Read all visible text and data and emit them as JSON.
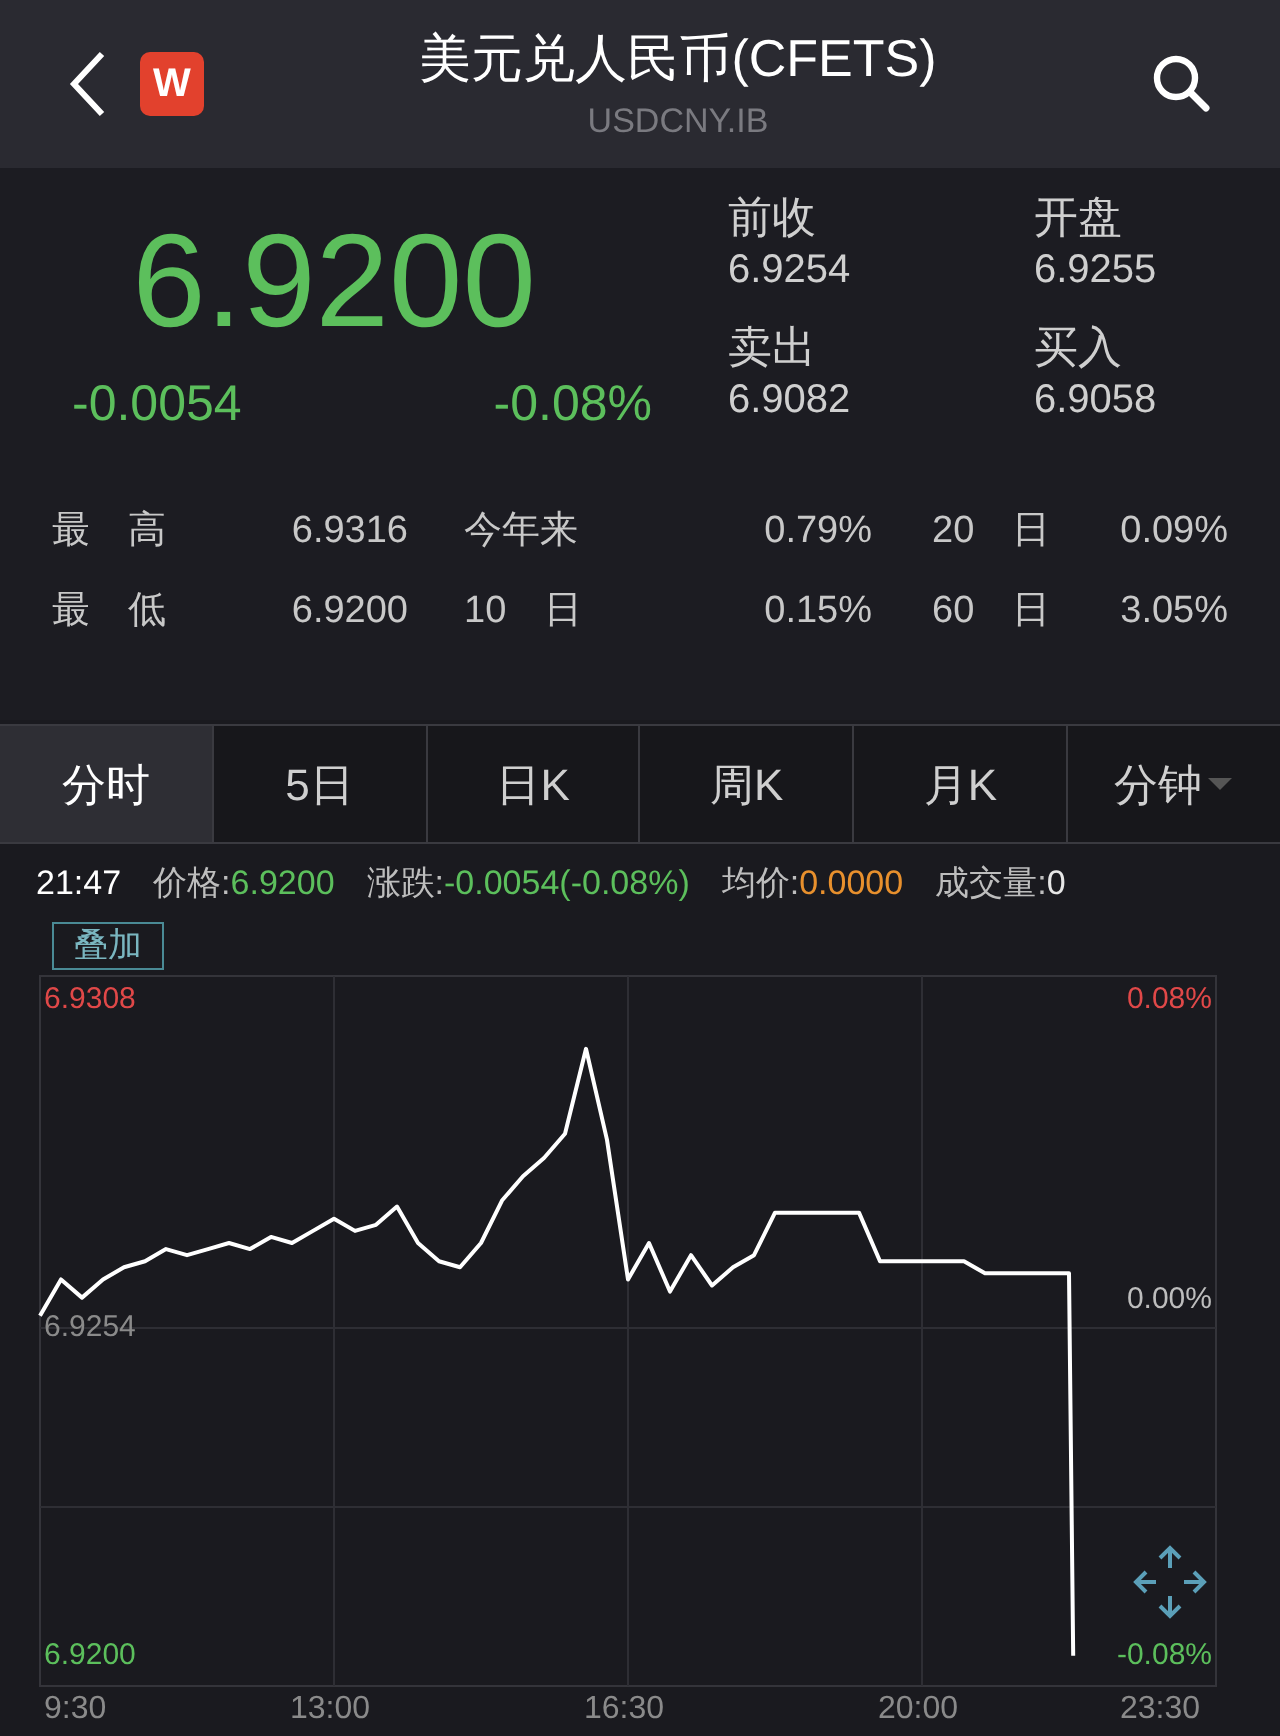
{
  "header": {
    "logo": "W",
    "title": "美元兑人民币(CFETS)",
    "subtitle": "USDCNY.IB"
  },
  "quote": {
    "price": "6.9200",
    "change": "-0.0054",
    "change_pct": "-0.08%",
    "fields": [
      {
        "label": "前收",
        "value": "6.9254"
      },
      {
        "label": "开盘",
        "value": "6.9255"
      },
      {
        "label": "卖出",
        "value": "6.9082"
      },
      {
        "label": "买入",
        "value": "6.9058"
      }
    ]
  },
  "stats": [
    [
      {
        "label": "最　高",
        "value": "6.9316"
      },
      {
        "label": "今年来",
        "value": "0.79%"
      },
      {
        "label": "20　日",
        "value": "0.09%"
      }
    ],
    [
      {
        "label": "最　低",
        "value": "6.9200"
      },
      {
        "label": "10　日",
        "value": "0.15%"
      },
      {
        "label": "60　日",
        "value": "3.05%"
      }
    ]
  ],
  "tabs": [
    {
      "label": "分时",
      "selected": true,
      "has_menu": false
    },
    {
      "label": "5日",
      "selected": false,
      "has_menu": false
    },
    {
      "label": "日K",
      "selected": false,
      "has_menu": false
    },
    {
      "label": "周K",
      "selected": false,
      "has_menu": false
    },
    {
      "label": "月K",
      "selected": false,
      "has_menu": false
    },
    {
      "label": "分钟",
      "selected": false,
      "has_menu": true
    }
  ],
  "info_line": {
    "time": "21:47",
    "items": [
      {
        "label": "价格:",
        "value": "6.9200",
        "color": "#5cbf5c"
      },
      {
        "label": "涨跌:",
        "value": "-0.0054(-0.08%)",
        "color": "#5cbf5c"
      },
      {
        "label": "均价:",
        "value": "0.0000",
        "color": "#e8902d"
      },
      {
        "label": "成交量:",
        "value": "0",
        "color": "#e6e6e6"
      }
    ]
  },
  "overlay_button": "叠加",
  "chart": {
    "right_labels": [
      {
        "label": "0.08%",
        "color": "#e04848"
      },
      {
        "label": "0.00%",
        "color": "#bdbdbd"
      },
      {
        "label": "-0.08%",
        "color": "#5cbf5c"
      }
    ],
    "chart_data": {
      "type": "line",
      "grid": true,
      "xlim": [
        9.5,
        23.5
      ],
      "ylim": [
        6.9195,
        6.9312
      ],
      "x": [
        9.5,
        9.75,
        10,
        10.25,
        10.5,
        10.75,
        11,
        11.25,
        11.5,
        11.75,
        12,
        12.25,
        12.5,
        12.75,
        13,
        13.25,
        13.5,
        13.75,
        14,
        14.25,
        14.5,
        14.75,
        15,
        15.25,
        15.5,
        15.75,
        16,
        16.25,
        16.5,
        16.75,
        17,
        17.25,
        17.5,
        17.75,
        18,
        18.25,
        18.5,
        18.75,
        19,
        19.25,
        19.5,
        19.75,
        20,
        20.25,
        20.5,
        20.75,
        21,
        21.25,
        21.5,
        21.75,
        21.8
      ],
      "xticks": [
        {
          "value": 9.5,
          "label": "9:30"
        },
        {
          "value": 13,
          "label": "13:00"
        },
        {
          "value": 16.5,
          "label": "16:30"
        },
        {
          "value": 20,
          "label": "20:00"
        },
        {
          "value": 23.5,
          "label": "23:30"
        }
      ],
      "yticks": [
        {
          "value": 6.9308,
          "label": "6.9308"
        },
        {
          "value": 6.9254,
          "label": "6.9254"
        },
        {
          "value": 6.92,
          "label": "6.9200"
        }
      ],
      "series": [
        {
          "color": "#ffffff",
          "values": [
            6.9256,
            6.9262,
            6.9259,
            6.9262,
            6.9264,
            6.9265,
            6.9267,
            6.9266,
            6.9267,
            6.9268,
            6.9267,
            6.9269,
            6.9268,
            6.927,
            6.9272,
            6.927,
            6.9271,
            6.9274,
            6.9268,
            6.9265,
            6.9264,
            6.9268,
            6.9275,
            6.9279,
            6.9282,
            6.9286,
            6.93,
            6.9285,
            6.9262,
            6.9268,
            6.926,
            6.9266,
            6.9261,
            6.9264,
            6.9266,
            6.9273,
            6.9273,
            6.9273,
            6.9273,
            6.9273,
            6.9265,
            6.9265,
            6.9265,
            6.9265,
            6.9265,
            6.9263,
            6.9263,
            6.9263,
            6.9263,
            6.9263,
            6.92
          ]
        }
      ]
    }
  }
}
